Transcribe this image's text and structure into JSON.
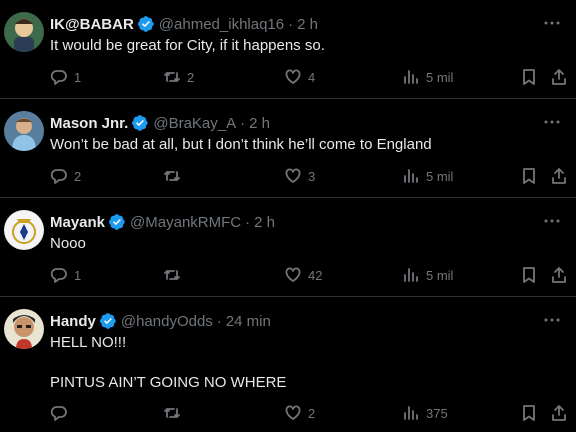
{
  "tweets": [
    {
      "name": "IK@BABAR",
      "handle": "@ahmed_ikhlaq16",
      "separator": "·",
      "time": "2 h",
      "text": "It would be great for City, if it happens so.",
      "replies": "1",
      "retweets": "2",
      "likes": "4",
      "views": "5 mil",
      "avatar_icon": "cartoon-character-avatar"
    },
    {
      "name": "Mason Jnr.",
      "handle": "@BraKay_A",
      "separator": "·",
      "time": "2 h",
      "text": "Won’t be bad at all, but I don’t think he’ll come to England",
      "replies": "2",
      "retweets": "",
      "likes": "3",
      "views": "5 mil",
      "avatar_icon": "football-player-avatar"
    },
    {
      "name": "Mayank",
      "handle": "@MayankRMFC",
      "separator": "·",
      "time": "2 h",
      "text": "Nooo",
      "replies": "1",
      "retweets": "",
      "likes": "42",
      "views": "5 mil",
      "avatar_icon": "club-crest-avatar"
    },
    {
      "name": "Handy",
      "handle": "@handyOdds",
      "separator": "·",
      "time": "24 min",
      "text": "HELL NO!!!\n\nPINTUS AIN’T GOING NO WHERE",
      "replies": "",
      "retweets": "",
      "likes": "2",
      "views": "375",
      "avatar_icon": "cartoon-man-avatar"
    }
  ],
  "colors": {
    "background": "#000000",
    "text": "#e7e9ea",
    "muted": "#71767b",
    "verified": "#1d9bf0",
    "divider": "#2f3336"
  }
}
